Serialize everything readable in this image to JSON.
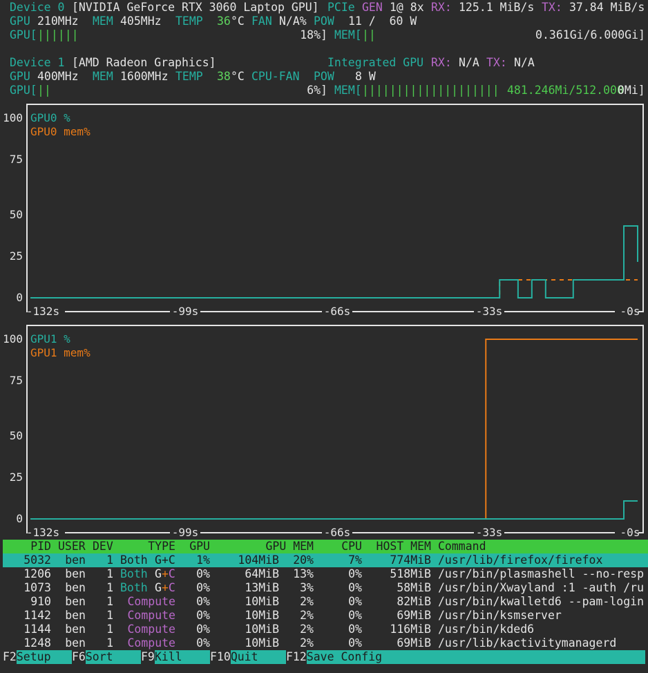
{
  "device0": {
    "label": "Device 0",
    "name": "[NVIDIA GeForce RTX 3060 Laptop GPU]",
    "pcie_label": "PCIe",
    "gen_label": "GEN",
    "gen_value": "1@ 8x",
    "rx_label": "RX:",
    "rx_value": "125.1 MiB/s",
    "tx_label": "TX:",
    "tx_value": "37.84 MiB/s",
    "gpu_clk_label": "GPU",
    "gpu_clk": "210MHz",
    "mem_clk_label": "MEM",
    "mem_clk": "405MHz",
    "temp_label": "TEMP",
    "temp": "36",
    "temp_unit": "°C",
    "fan_label": "FAN",
    "fan": "N/A%",
    "pow_label": "POW",
    "pow": "11 /  60 W",
    "gpu_bar_label": "GPU[",
    "gpu_bar": "||||||",
    "gpu_pct": "18%]",
    "mem_bar_label": "MEM[",
    "mem_bar": "||",
    "mem_value": "0.361Gi/6.000Gi]"
  },
  "device1": {
    "label": "Device 1",
    "name": "[AMD Radeon Graphics]",
    "kind": "Integrated GPU",
    "rx_label": "RX:",
    "rx_value": "N/A",
    "tx_label": "TX:",
    "tx_value": "N/A",
    "gpu_clk_label": "GPU",
    "gpu_clk": "400MHz",
    "mem_clk_label": "MEM",
    "mem_clk": "1600MHz",
    "temp_label": "TEMP",
    "temp": "38",
    "temp_unit": "°C",
    "fan_label": "CPU-FAN",
    "pow_label": "POW",
    "pow": "8 W",
    "gpu_bar_label": "GPU[",
    "gpu_bar": "||",
    "gpu_pct": "6%]",
    "mem_bar_label": "MEM[",
    "mem_bar": "||||||||||||||||||||",
    "mem_value": "481.246Mi/512.000",
    "mem_value_end": "0Mi]"
  },
  "chart_data": [
    {
      "type": "line",
      "y_ticks": [
        "100",
        "75",
        "50",
        "25",
        "0"
      ],
      "x_ticks": [
        "-132s",
        "-99s",
        "-66s",
        "-33s",
        "-0s"
      ],
      "ylim": [
        0,
        100
      ],
      "x": [
        -132,
        -33,
        -30,
        -26,
        -23,
        -20,
        -14,
        -8,
        -3,
        0
      ],
      "series": [
        {
          "name": "GPU0 %",
          "color": "#26b0a0",
          "values": [
            0,
            0,
            10,
            0,
            10,
            0,
            10,
            10,
            40,
            20
          ]
        },
        {
          "name": "GPU0 mem%",
          "color": "#e87a18",
          "values": [
            0,
            0,
            10,
            10,
            10,
            10,
            10,
            10,
            10,
            10
          ]
        }
      ]
    },
    {
      "type": "line",
      "y_ticks": [
        "100",
        "75",
        "50",
        "25",
        "0"
      ],
      "x_ticks": [
        "-132s",
        "-99s",
        "-66s",
        "-33s",
        "-0s"
      ],
      "ylim": [
        0,
        100
      ],
      "x": [
        -132,
        -33,
        -8,
        -3,
        0
      ],
      "series": [
        {
          "name": "GPU1 %",
          "color": "#26b0a0",
          "values": [
            0,
            0,
            0,
            10,
            10
          ]
        },
        {
          "name": "GPU1 mem%",
          "color": "#e87a18",
          "values": [
            0,
            100,
            100,
            100,
            100
          ]
        }
      ]
    }
  ],
  "table": {
    "headers": [
      "PID",
      "USER",
      "DEV",
      "TYPE",
      "GPU",
      "GPU MEM",
      "CPU",
      "HOST MEM",
      "Command"
    ],
    "rows": [
      {
        "pid": "5032",
        "user": "ben",
        "dev": "1",
        "type_a": "Both",
        "type_b": "G+C",
        "gpu": "1%",
        "gmem": "104MiB",
        "gmemp": "20%",
        "cpu": "7%",
        "hmem": "774MiB",
        "cmd": "/usr/lib/firefox/firefox"
      },
      {
        "pid": "1206",
        "user": "ben",
        "dev": "1",
        "type_a": "Both",
        "type_b": "G+C",
        "gpu": "0%",
        "gmem": "64MiB",
        "gmemp": "13%",
        "cpu": "0%",
        "hmem": "518MiB",
        "cmd": "/usr/bin/plasmashell --no-resp"
      },
      {
        "pid": "1073",
        "user": "ben",
        "dev": "1",
        "type_a": "Both",
        "type_b": "G+C",
        "gpu": "0%",
        "gmem": "13MiB",
        "gmemp": "3%",
        "cpu": "0%",
        "hmem": "58MiB",
        "cmd": "/usr/bin/Xwayland :1 -auth /ru"
      },
      {
        "pid": "910",
        "user": "ben",
        "dev": "1",
        "type_a": "",
        "type_b": "Compute",
        "gpu": "0%",
        "gmem": "10MiB",
        "gmemp": "2%",
        "cpu": "0%",
        "hmem": "82MiB",
        "cmd": "/usr/bin/kwalletd6 --pam-login"
      },
      {
        "pid": "1142",
        "user": "ben",
        "dev": "1",
        "type_a": "",
        "type_b": "Compute",
        "gpu": "0%",
        "gmem": "10MiB",
        "gmemp": "2%",
        "cpu": "0%",
        "hmem": "69MiB",
        "cmd": "/usr/bin/ksmserver"
      },
      {
        "pid": "1144",
        "user": "ben",
        "dev": "1",
        "type_a": "",
        "type_b": "Compute",
        "gpu": "0%",
        "gmem": "10MiB",
        "gmemp": "2%",
        "cpu": "0%",
        "hmem": "116MiB",
        "cmd": "/usr/bin/kded6"
      },
      {
        "pid": "1248",
        "user": "ben",
        "dev": "1",
        "type_a": "",
        "type_b": "Compute",
        "gpu": "0%",
        "gmem": "10MiB",
        "gmemp": "2%",
        "cpu": "0%",
        "hmem": "69MiB",
        "cmd": "/usr/lib/kactivitymanagerd"
      }
    ]
  },
  "footer": [
    {
      "key": "F2",
      "label": "Setup"
    },
    {
      "key": "F6",
      "label": "Sort"
    },
    {
      "key": "F9",
      "label": "Kill"
    },
    {
      "key": "F10",
      "label": "Quit"
    },
    {
      "key": "F12",
      "label": "Save Config"
    }
  ]
}
